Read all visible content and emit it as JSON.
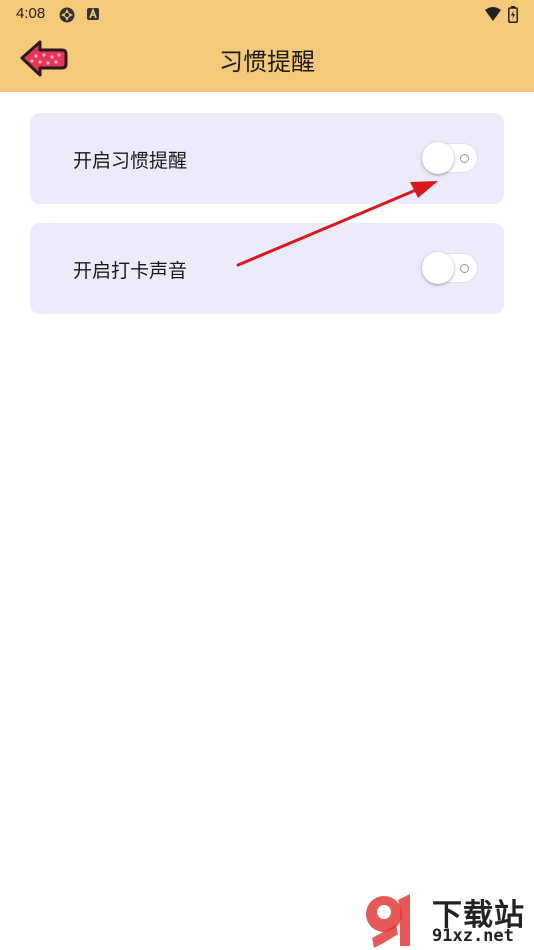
{
  "status_bar": {
    "time": "4:08",
    "left_icons": [
      "settings-gear-icon",
      "a-badge-icon"
    ],
    "right_icons": [
      "wifi-icon",
      "battery-icon"
    ]
  },
  "app_bar": {
    "title": "习惯提醒",
    "back_icon": "back-arrow-icon",
    "background_color": "#f5c97a"
  },
  "settings": [
    {
      "label": "开启习惯提醒",
      "toggle_on": false
    },
    {
      "label": "开启打卡声音",
      "toggle_on": false
    }
  ],
  "colors": {
    "card_background": "#ebebfc",
    "annotation_arrow": "#d9181f",
    "back_arrow_fill": "#e8335a"
  },
  "watermark": {
    "logo_text": "91",
    "top_text": "下载站",
    "bottom_text": "91xz.net"
  }
}
